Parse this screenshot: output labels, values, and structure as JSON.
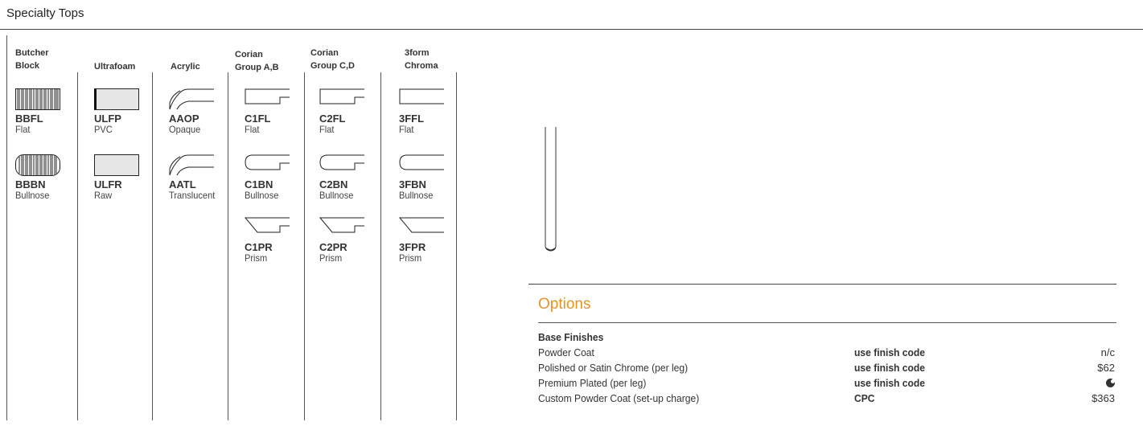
{
  "section": {
    "title": "Specialty Tops"
  },
  "columns": [
    {
      "header_lines": [
        "Butcher",
        "Block"
      ],
      "items": [
        {
          "code": "BBFL",
          "desc": "Flat",
          "icon": "butcher-block-flat-icon"
        },
        {
          "code": "BBBN",
          "desc": "Bullnose",
          "icon": "butcher-block-bullnose-icon"
        }
      ]
    },
    {
      "header_lines": [
        "Ultrafoam"
      ],
      "items": [
        {
          "code": "ULFP",
          "desc": "PVC",
          "icon": "ultrafoam-pvc-icon"
        },
        {
          "code": "ULFR",
          "desc": "Raw",
          "icon": "ultrafoam-raw-icon"
        }
      ]
    },
    {
      "header_lines": [
        "Acrylic"
      ],
      "items": [
        {
          "code": "AAOP",
          "desc": "Opaque",
          "icon": "acrylic-opaque-edge-icon"
        },
        {
          "code": "AATL",
          "desc": "Translucent",
          "icon": "acrylic-translucent-edge-icon"
        }
      ]
    },
    {
      "header_lines": [
        "Corian",
        "Group A,B"
      ],
      "items": [
        {
          "code": "C1FL",
          "desc": "Flat",
          "icon": "flat-edge-icon"
        },
        {
          "code": "C1BN",
          "desc": "Bullnose",
          "icon": "bullnose-edge-icon"
        },
        {
          "code": "C1PR",
          "desc": "Prism",
          "icon": "prism-edge-icon"
        }
      ]
    },
    {
      "header_lines": [
        "Corian",
        "Group C,D"
      ],
      "items": [
        {
          "code": "C2FL",
          "desc": "Flat",
          "icon": "flat-edge-icon"
        },
        {
          "code": "C2BN",
          "desc": "Bullnose",
          "icon": "bullnose-edge-icon"
        },
        {
          "code": "C2PR",
          "desc": "Prism",
          "icon": "prism-edge-icon"
        }
      ]
    },
    {
      "header_lines": [
        "3form",
        "Chroma"
      ],
      "items": [
        {
          "code": "3FFL",
          "desc": "Flat",
          "icon": "flat-edge-icon"
        },
        {
          "code": "3FBN",
          "desc": "Bullnose",
          "icon": "bullnose-edge-icon"
        },
        {
          "code": "3FPR",
          "desc": "Prism",
          "icon": "prism-edge-icon"
        }
      ]
    }
  ],
  "options": {
    "title": "Options",
    "title_color": "#e8931c",
    "base_finishes": {
      "heading": "Base Finishes",
      "rows": [
        {
          "name": "Powder Coat",
          "code": "use finish code",
          "price": "n/c"
        },
        {
          "name": "Polished or Satin Chrome (per leg)",
          "code": "use finish code",
          "price": "$62"
        },
        {
          "name": "Premium Plated (per leg)",
          "code": "use finish code",
          "price": "",
          "price_icon": "quote-moon-icon"
        },
        {
          "name": "Custom Powder Coat (set-up charge)",
          "code": "CPC",
          "price": "$363"
        }
      ]
    }
  }
}
